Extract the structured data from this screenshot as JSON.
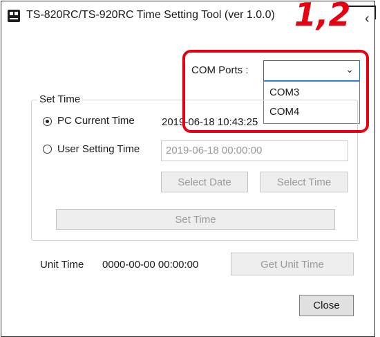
{
  "window": {
    "title": "TS-820RC/TS-920RC Time Setting Tool (ver 1.0.0)",
    "close_glyph": "‹"
  },
  "annotation": {
    "step_label": "1,2",
    "highlight_color": "#e60012"
  },
  "com_ports": {
    "label": "COM Ports :",
    "selected_value": "",
    "options": [
      "COM3",
      "COM4"
    ]
  },
  "set_time_group": {
    "title": "Set Time",
    "pc_current_time": {
      "label": "PC Current Time",
      "value": "2019-06-18 10:43:25",
      "selected": true
    },
    "user_setting_time": {
      "label": "User Setting Time",
      "value": "2019-06-18 00:00:00",
      "selected": false
    },
    "select_date_label": "Select Date",
    "select_time_label": "Select Time",
    "set_time_label": "Set Time"
  },
  "unit_time": {
    "label": "Unit Time",
    "value": "0000-00-00 00:00:00",
    "get_unit_time_label": "Get Unit Time"
  },
  "close_label": "Close",
  "colors": {
    "accent": "#2a73c9",
    "disabled_text": "#9a9a9a"
  }
}
